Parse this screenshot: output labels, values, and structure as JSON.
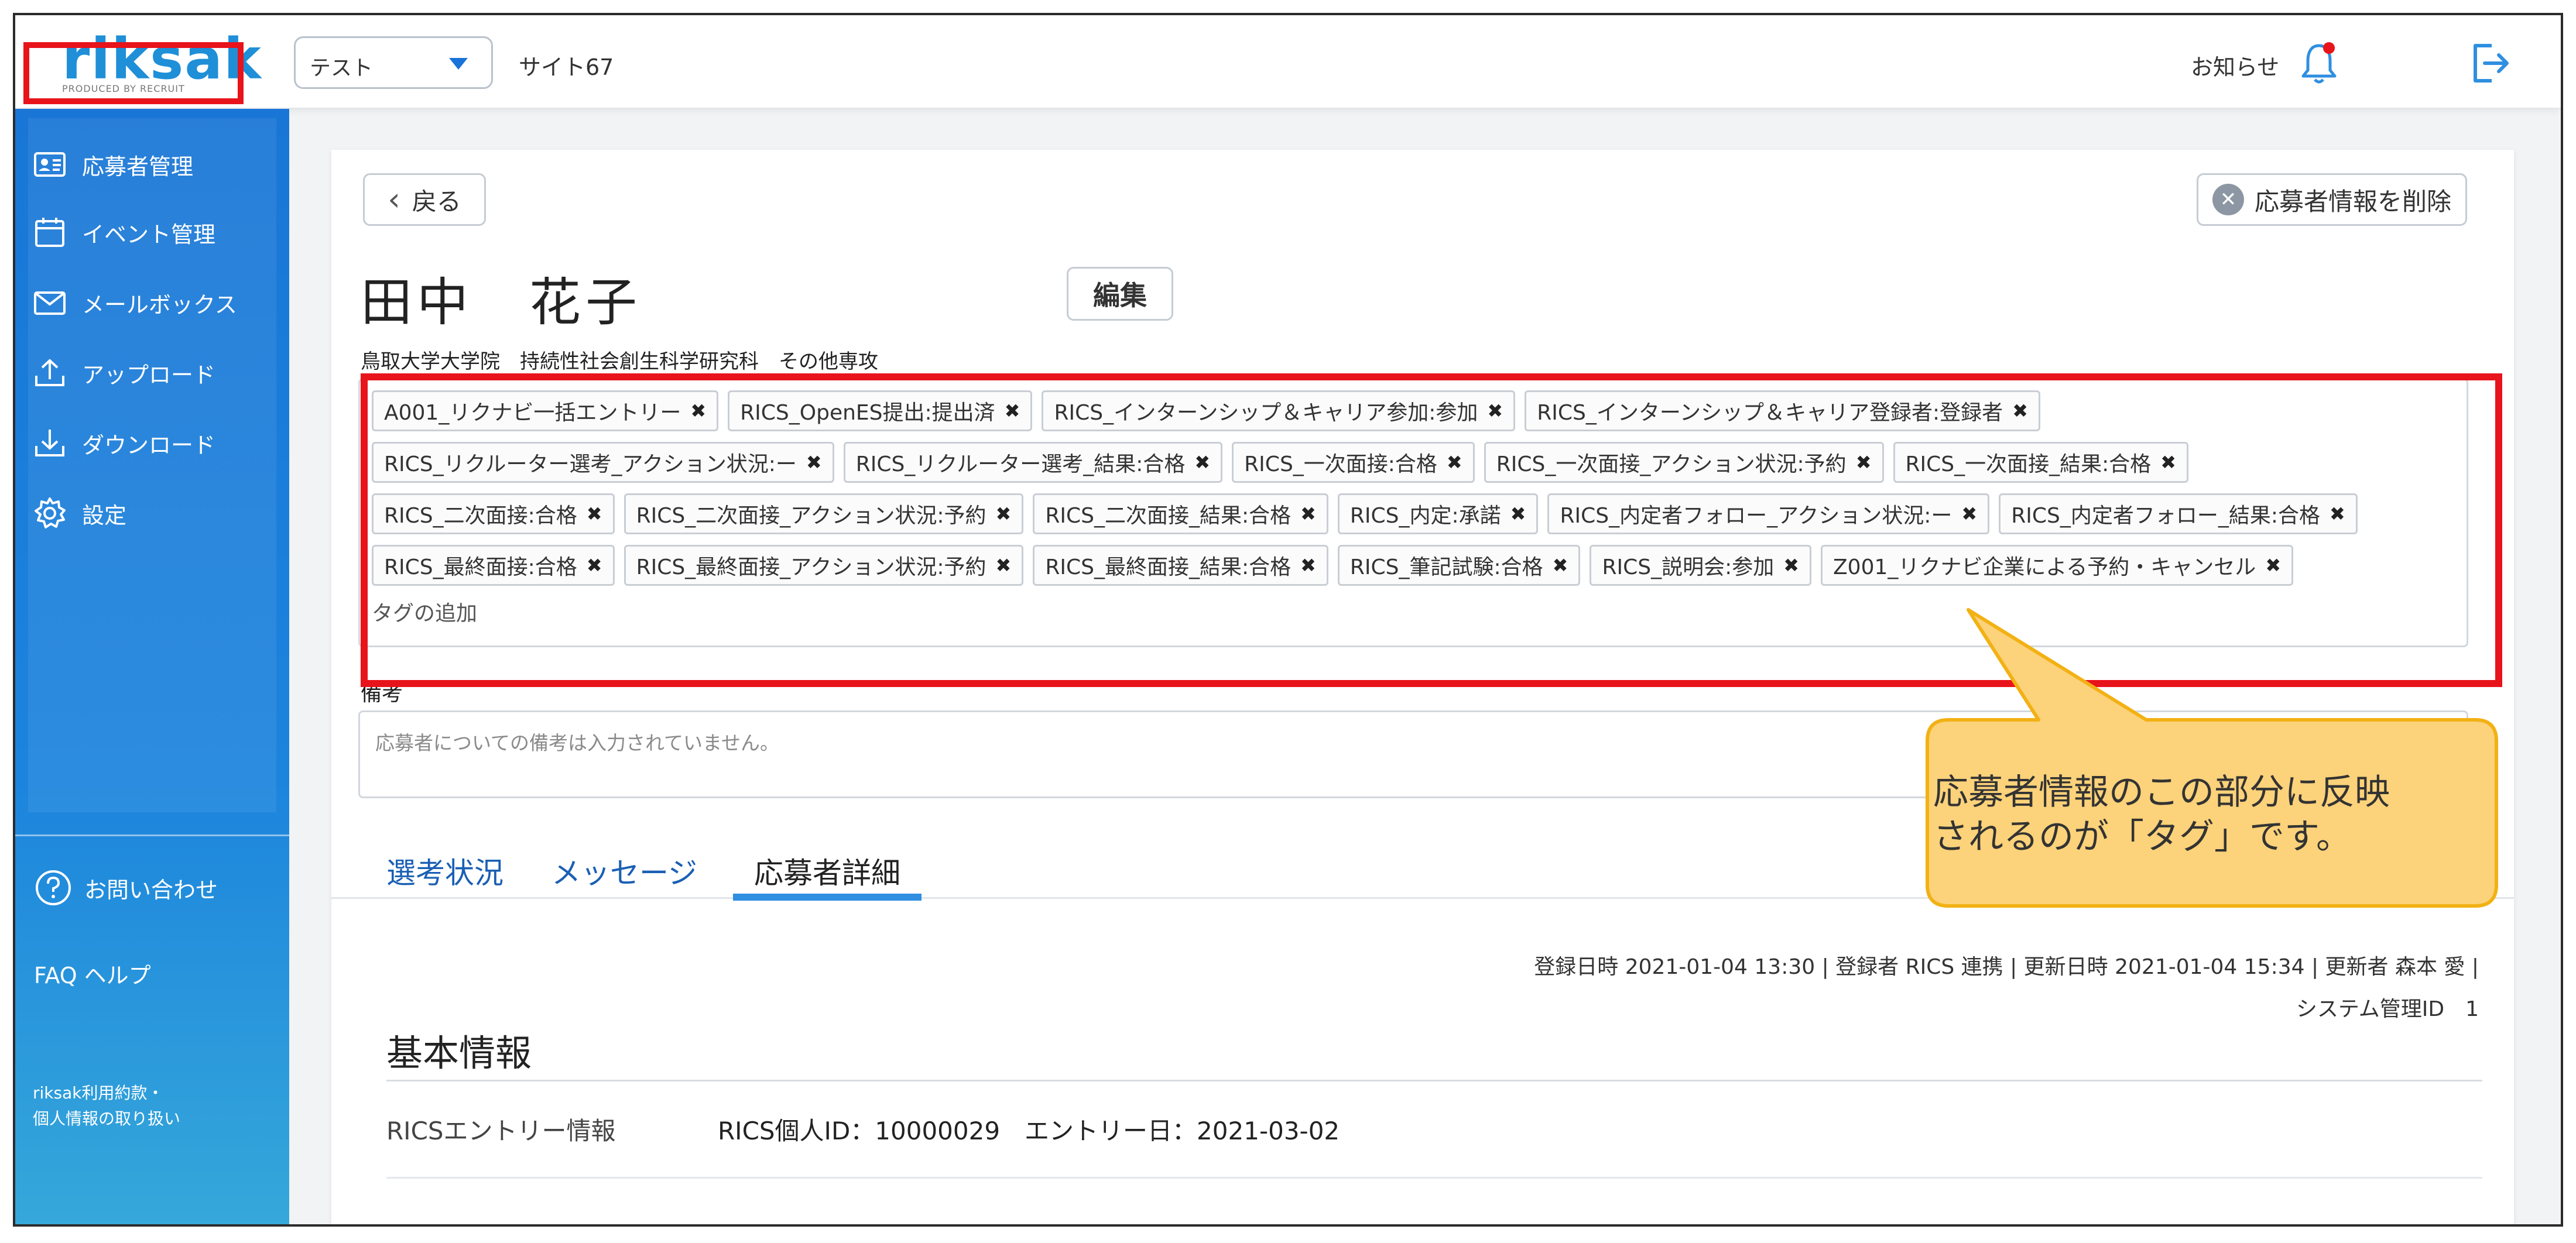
{
  "header": {
    "logo_text": "riksak",
    "logo_sub": "PRODUCED BY RECRUIT",
    "company_select_value": "テスト",
    "site_name": "サイト67",
    "notice_label": "お知らせ"
  },
  "sidebar": {
    "items": [
      {
        "label": "応募者管理",
        "icon": "id-card-icon"
      },
      {
        "label": "イベント管理",
        "icon": "calendar-icon"
      },
      {
        "label": "メールボックス",
        "icon": "mail-icon"
      },
      {
        "label": "アップロード",
        "icon": "upload-icon"
      },
      {
        "label": "ダウンロード",
        "icon": "download-icon"
      },
      {
        "label": "設定",
        "icon": "gear-icon"
      }
    ],
    "contact_label": "お問い合わせ",
    "faq_label": "FAQ ヘルプ",
    "terms_line1": "riksak利用約款・",
    "terms_line2": "個人情報の取り扱い"
  },
  "page": {
    "back_label": "戻る",
    "delete_label": "応募者情報を削除",
    "applicant_name": "田中　花子",
    "edit_label": "編集",
    "affiliation": "鳥取大学大学院　持続性社会創生科学研究科　その他専攻",
    "tag_rows": [
      [
        "A001_リクナビ一括エントリー",
        "RICS_OpenES提出:提出済",
        "RICS_インターンシップ＆キャリア参加:参加",
        "RICS_インターンシップ＆キャリア登録者:登録者"
      ],
      [
        "RICS_リクルーター選考_アクション状況:ー",
        "RICS_リクルーター選考_結果:合格",
        "RICS_一次面接:合格",
        "RICS_一次面接_アクション状況:予約",
        "RICS_一次面接_結果:合格"
      ],
      [
        "RICS_二次面接:合格",
        "RICS_二次面接_アクション状況:予約",
        "RICS_二次面接_結果:合格",
        "RICS_内定:承諾",
        "RICS_内定者フォロー_アクション状況:ー",
        "RICS_内定者フォロー_結果:合格"
      ],
      [
        "RICS_最終面接:合格",
        "RICS_最終面接_アクション状況:予約",
        "RICS_最終面接_結果:合格",
        "RICS_筆記試験:合格",
        "RICS_説明会:参加",
        "Z001_リクナビ企業による予約・キャンセル"
      ]
    ],
    "tag_add_placeholder": "タグの追加",
    "remarks_label": "備考",
    "remarks_placeholder": "応募者についての備考は入力されていません。",
    "tabs": [
      "選考状況",
      "メッセージ",
      "応募者詳細"
    ],
    "active_tab": "応募者詳細",
    "meta_line": "登録日時 2021-01-04 13:30 | 登録者 RICS 連携 | 更新日時 2021-01-04 15:34 | 更新者 森本 愛 |",
    "meta_id": "システム管理ID　1",
    "section_title": "基本情報",
    "rics_label": "RICSエントリー情報",
    "rics_value": "RICS個人ID：10000029　エントリー日：2021-03-02"
  },
  "callout": {
    "line1": "応募者情報のこの部分に反映",
    "line2": "されるのが「タグ」です。"
  },
  "colors": {
    "sidebar": "#1976d6",
    "highlight": "#e8141b",
    "callout_fill": "#fcd27a",
    "callout_border": "#f2b114",
    "link": "#1a5fb4",
    "tab_underline": "#2f8fe0"
  }
}
